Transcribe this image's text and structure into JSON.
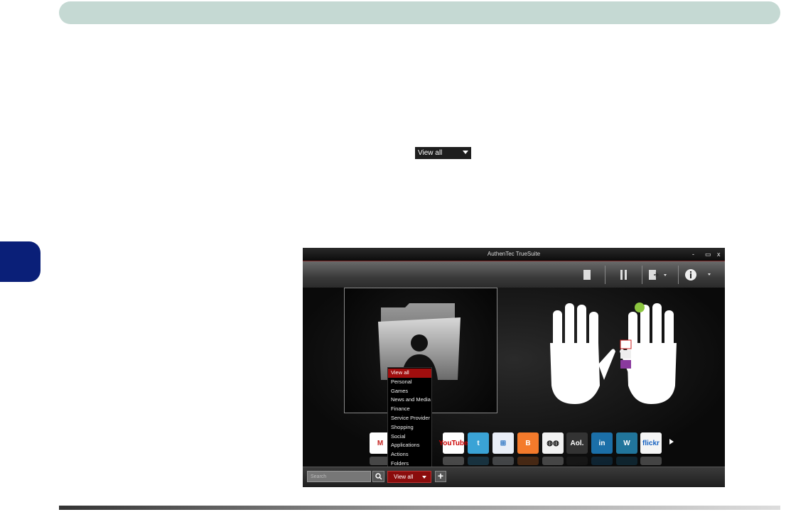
{
  "inline_control": {
    "label": "View all"
  },
  "app": {
    "title": "AuthenTec TrueSuite",
    "window_controls": [
      "-",
      "▭",
      "x"
    ],
    "bottom": {
      "search_placeholder": "Search",
      "view_filter": "View all"
    },
    "dropdown_items": [
      "View all",
      "Personal",
      "Games",
      "News and Media",
      "Finance",
      "Service Provider",
      "Shopping",
      "Social",
      "Applications",
      "Actions",
      "Folders"
    ],
    "apps": [
      {
        "name": "gmail",
        "label": "M",
        "color": "#ffffff",
        "fg": "#c5221f"
      },
      {
        "name": "yahoo",
        "label": "",
        "color": "#7b2c9e",
        "fg": "#ffffff"
      },
      {
        "name": "youtube",
        "label": "YouTube",
        "color": "#ffffff",
        "fg": "#cc0000"
      },
      {
        "name": "twitter",
        "label": "t",
        "color": "#3aa3d6",
        "fg": "#ffffff"
      },
      {
        "name": "windows-live",
        "label": "⊞",
        "color": "#e9eef7",
        "fg": "#1c6bbf"
      },
      {
        "name": "blogger",
        "label": "B",
        "color": "#f47a2b",
        "fg": "#ffffff"
      },
      {
        "name": "myspace",
        "label": "◍◍",
        "color": "#f2f2f2",
        "fg": "#111111"
      },
      {
        "name": "aol",
        "label": "Aol.",
        "color": "#333333",
        "fg": "#ffffff"
      },
      {
        "name": "linkedin",
        "label": "in",
        "color": "#1b6fa8",
        "fg": "#ffffff"
      },
      {
        "name": "wordpress",
        "label": "W",
        "color": "#21759b",
        "fg": "#ffffff"
      },
      {
        "name": "flickr",
        "label": "flickr",
        "color": "#f5f5f5",
        "fg": "#1460c0"
      }
    ]
  }
}
